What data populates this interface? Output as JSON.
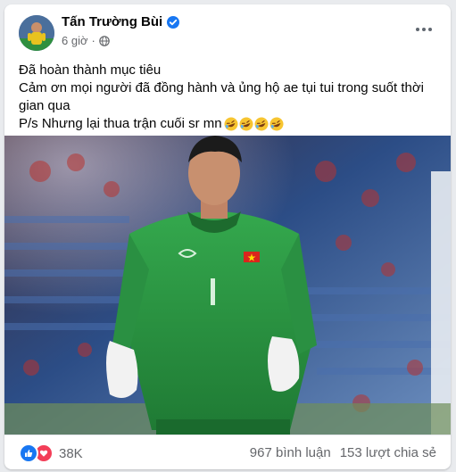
{
  "post": {
    "author": "Tấn Trường Bùi",
    "time": "6 giờ",
    "separator": "·",
    "lines": [
      "Đã hoàn thành mục tiêu",
      "Cảm ơn mọi người đã đồng hành và ủng hộ ae tụi tui trong suốt thời gian qua",
      "P/s Nhưng lại thua trận cuối sr mn"
    ],
    "emoji_names": [
      "rofl-emoji",
      "rofl-emoji",
      "rofl-emoji",
      "rofl-emoji"
    ]
  },
  "footer": {
    "reaction_count": "38K",
    "comments": "967 bình luận",
    "shares": "153 lượt chia sẻ"
  },
  "icons": {
    "verified": "verified-badge-icon",
    "privacy": "globe-icon",
    "more": "more-options-icon",
    "like": "like-reaction-icon",
    "love": "love-reaction-icon"
  },
  "colors": {
    "accent": "#1877f2",
    "love": "#f33e58",
    "jersey": "#2e9b45",
    "secondary_text": "#65676b"
  }
}
